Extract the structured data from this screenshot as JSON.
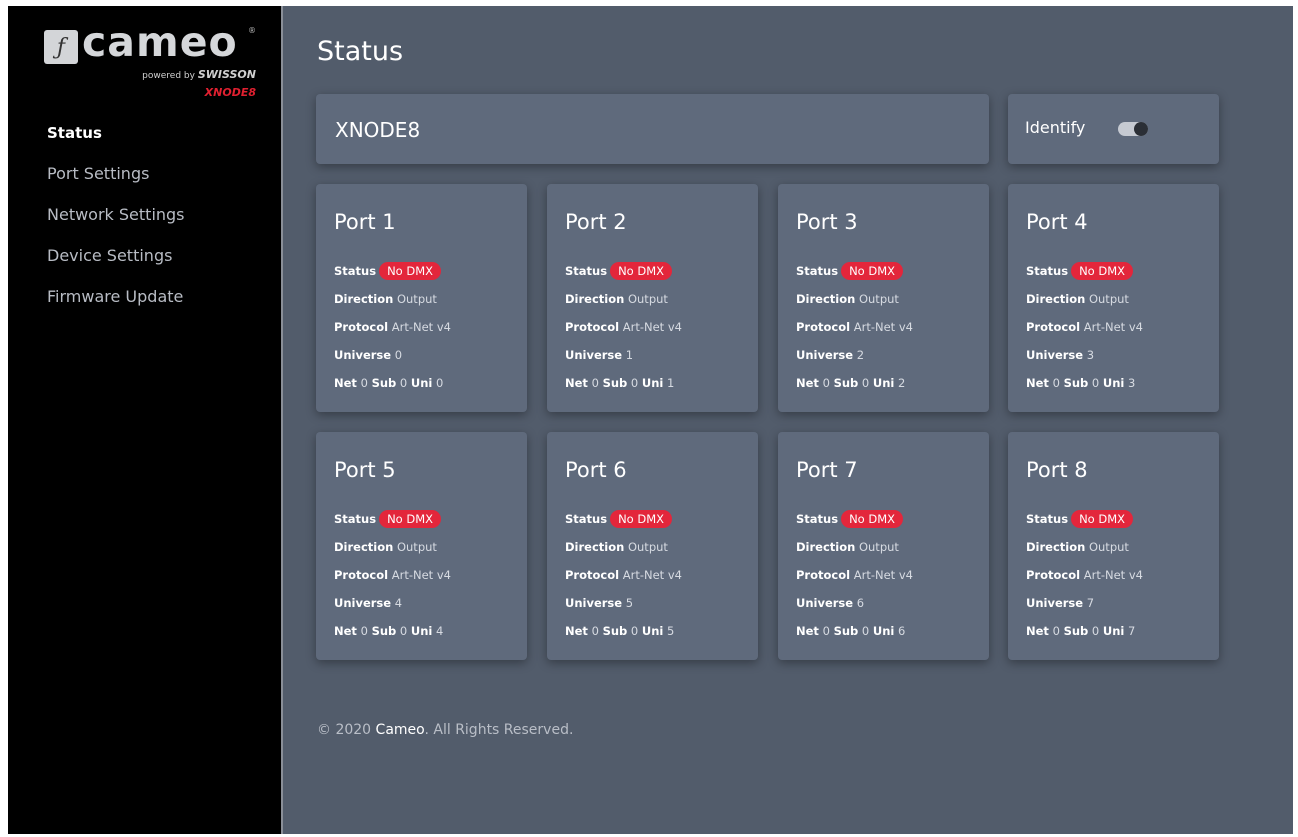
{
  "logo": {
    "wordmark": "cameo",
    "registered": "®",
    "powered_by": "powered by",
    "powered_brand": "SWISSON",
    "model": "XNODE8"
  },
  "nav": [
    {
      "label": "Status",
      "active": true
    },
    {
      "label": "Port Settings",
      "active": false
    },
    {
      "label": "Network Settings",
      "active": false
    },
    {
      "label": "Device Settings",
      "active": false
    },
    {
      "label": "Firmware Update",
      "active": false
    }
  ],
  "page": {
    "title": "Status"
  },
  "device": {
    "name": "XNODE8"
  },
  "identify": {
    "label": "Identify",
    "state": "off"
  },
  "labels": {
    "status": "Status",
    "direction": "Direction",
    "protocol": "Protocol",
    "universe": "Universe",
    "net": "Net",
    "sub": "Sub",
    "uni": "Uni"
  },
  "ports": [
    {
      "title": "Port 1",
      "status": "No DMX",
      "direction": "Output",
      "protocol": "Art-Net v4",
      "universe": "0",
      "net": "0",
      "sub": "0",
      "uni": "0"
    },
    {
      "title": "Port 2",
      "status": "No DMX",
      "direction": "Output",
      "protocol": "Art-Net v4",
      "universe": "1",
      "net": "0",
      "sub": "0",
      "uni": "1"
    },
    {
      "title": "Port 3",
      "status": "No DMX",
      "direction": "Output",
      "protocol": "Art-Net v4",
      "universe": "2",
      "net": "0",
      "sub": "0",
      "uni": "2"
    },
    {
      "title": "Port 4",
      "status": "No DMX",
      "direction": "Output",
      "protocol": "Art-Net v4",
      "universe": "3",
      "net": "0",
      "sub": "0",
      "uni": "3"
    },
    {
      "title": "Port 5",
      "status": "No DMX",
      "direction": "Output",
      "protocol": "Art-Net v4",
      "universe": "4",
      "net": "0",
      "sub": "0",
      "uni": "4"
    },
    {
      "title": "Port 6",
      "status": "No DMX",
      "direction": "Output",
      "protocol": "Art-Net v4",
      "universe": "5",
      "net": "0",
      "sub": "0",
      "uni": "5"
    },
    {
      "title": "Port 7",
      "status": "No DMX",
      "direction": "Output",
      "protocol": "Art-Net v4",
      "universe": "6",
      "net": "0",
      "sub": "0",
      "uni": "6"
    },
    {
      "title": "Port 8",
      "status": "No DMX",
      "direction": "Output",
      "protocol": "Art-Net v4",
      "universe": "7",
      "net": "0",
      "sub": "0",
      "uni": "7"
    }
  ],
  "footer": {
    "prefix": "© 2020",
    "brand": "Cameo",
    "suffix": ". All Rights Reserved."
  },
  "colors": {
    "sidebar": "#000000",
    "main": "#525c6b",
    "card": "#5f6a7c",
    "badge": "#e3263b",
    "model_tag": "#e02030"
  }
}
